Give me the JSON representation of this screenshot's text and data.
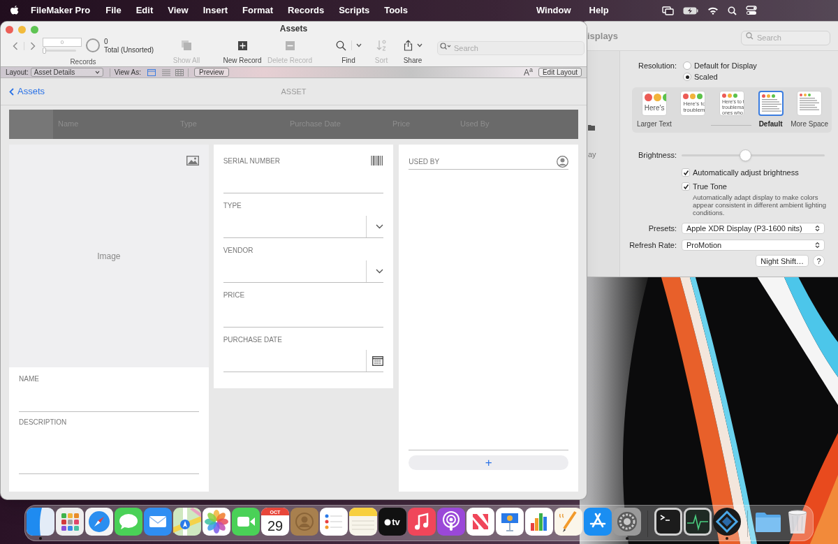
{
  "menu_bar": {
    "app_name": "FileMaker Pro",
    "menus": [
      "File",
      "Edit",
      "View",
      "Insert",
      "Format",
      "Records",
      "Scripts",
      "Tools"
    ],
    "menus_right": [
      "Window",
      "Help"
    ]
  },
  "displays_window": {
    "title": "isplays",
    "search": {
      "placeholder": "Search"
    },
    "sidebar_text": "ay",
    "resolution": {
      "label": "Resolution:",
      "options": [
        {
          "label": "Default for Display",
          "selected": false
        },
        {
          "label": "Scaled",
          "selected": true
        }
      ]
    },
    "scales": [
      {
        "label": "Larger Text",
        "selected": false,
        "sample": [
          "Here's"
        ]
      },
      {
        "selected": false,
        "sample": [
          "Here's to",
          "troublem"
        ]
      },
      {
        "selected": false,
        "sample": [
          "Here's to t",
          "troublema",
          "ones who"
        ]
      },
      {
        "label": "Default",
        "selected": true
      },
      {
        "label": "More Space",
        "selected": false
      }
    ],
    "brightness": {
      "label": "Brightness:",
      "level": 0.44
    },
    "checkboxes": [
      {
        "label": "Automatically adjust brightness",
        "checked": true
      },
      {
        "label": "True Tone",
        "checked": true
      }
    ],
    "note": "Automatically adapt display to make colors appear consistent in different ambient lighting conditions.",
    "selects": [
      {
        "label": "Presets:",
        "value": "Apple XDR Display (P3-1600 nits)"
      },
      {
        "label": "Refresh Rate:",
        "value": "ProMotion"
      }
    ],
    "buttons": [
      "Night Shift…",
      "?"
    ]
  },
  "filemaker_window": {
    "title": "Assets",
    "toolbar": {
      "record_number": "0",
      "record_slider": {
        "level": 0
      },
      "found_count": "0",
      "total_label": "Total (Unsorted)",
      "records_label": "Records",
      "buttons": [
        {
          "kind": "show_all",
          "label": "Show All",
          "disabled": true
        },
        {
          "kind": "new_record",
          "label": "New Record",
          "disabled": false
        },
        {
          "kind": "delete_record",
          "label": "Delete Record",
          "disabled": true
        },
        {
          "kind": "find",
          "label": "Find",
          "disabled": false
        },
        {
          "kind": "sort",
          "label": "Sort",
          "disabled": true
        },
        {
          "kind": "share",
          "label": "Share",
          "disabled": false
        }
      ],
      "search": {
        "placeholder": "Search"
      }
    },
    "layout_bar": {
      "layout_label": "Layout:",
      "layout": "Asset Details",
      "view_as_label": "View As:",
      "views": [
        {
          "kind": "form",
          "selected": true
        },
        {
          "kind": "list",
          "selected": false
        },
        {
          "kind": "table",
          "selected": false
        }
      ],
      "preview": "Preview",
      "text_size": "A$^{a}$",
      "edit_layout": "Edit Layout"
    },
    "header": {
      "back": "Assets",
      "title": "ASSET"
    },
    "table": {
      "columns": [
        "Name",
        "Type",
        "Purchase Date",
        "Price",
        "Used By"
      ]
    },
    "image_card": {
      "placeholder": "Image",
      "fields": [
        {
          "label": "NAME"
        },
        {
          "label": "DESCRIPTION"
        }
      ]
    },
    "detail_fields": [
      {
        "label": "SERIAL NUMBER",
        "kind": "barcode"
      },
      {
        "label": "TYPE",
        "kind": "dropdown"
      },
      {
        "label": "VENDOR",
        "kind": "dropdown"
      },
      {
        "label": "PRICE",
        "kind": "text"
      },
      {
        "label": "PURCHASE DATE",
        "kind": "date"
      }
    ],
    "used_by": {
      "label": "USED BY",
      "add": "+"
    }
  },
  "dock": [
    {
      "kind": "finder",
      "running": true
    },
    {
      "kind": "launchpad",
      "running": false
    },
    {
      "kind": "safari",
      "running": false
    },
    {
      "kind": "messages",
      "running": false
    },
    {
      "kind": "mail",
      "running": false
    },
    {
      "kind": "maps",
      "running": false
    },
    {
      "kind": "photos",
      "running": false
    },
    {
      "kind": "facetime",
      "running": false
    },
    {
      "kind": "calendar",
      "month": "OCT",
      "day": "29",
      "running": false
    },
    {
      "kind": "contacts",
      "running": false
    },
    {
      "kind": "reminders",
      "running": false
    },
    {
      "kind": "notes",
      "running": false
    },
    {
      "kind": "tv",
      "label": "tv",
      "running": false
    },
    {
      "kind": "music",
      "running": false
    },
    {
      "kind": "podcasts",
      "running": false
    },
    {
      "kind": "news",
      "running": false
    },
    {
      "kind": "keynote",
      "running": false
    },
    {
      "kind": "numbers",
      "running": false
    },
    {
      "kind": "pages",
      "running": false
    },
    {
      "kind": "app_store",
      "running": false
    },
    {
      "kind": "system_preferences",
      "running": true
    },
    {
      "kind": "separator"
    },
    {
      "kind": "terminal",
      "running": false
    },
    {
      "kind": "activity_monitor",
      "running": false
    },
    {
      "kind": "filemaker",
      "running": true
    },
    {
      "kind": "separator"
    },
    {
      "kind": "folder",
      "running": false
    },
    {
      "kind": "trash",
      "running": false
    }
  ]
}
